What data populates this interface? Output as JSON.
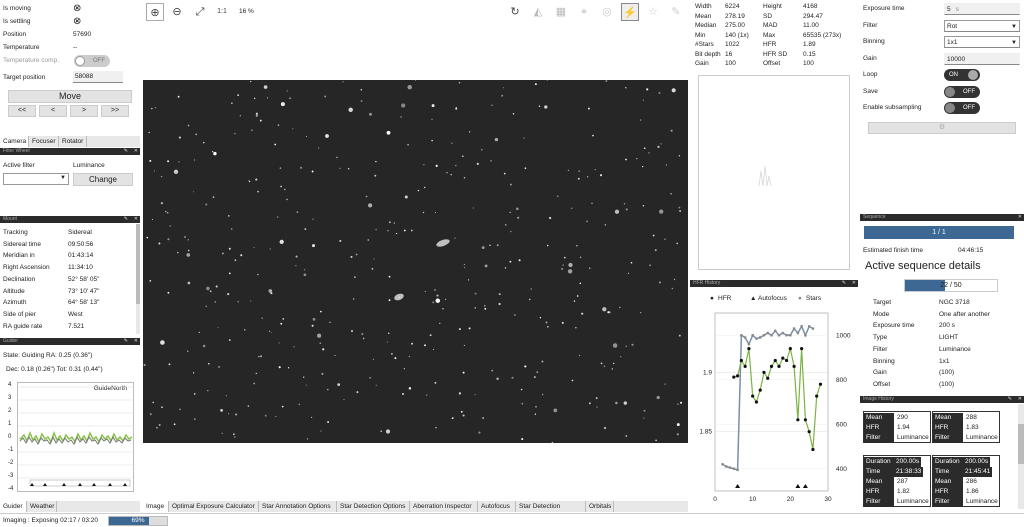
{
  "focuser": {
    "rows": [
      {
        "k": "Is moving",
        "v": "⊗"
      },
      {
        "k": "Is settling",
        "v": "⊗"
      },
      {
        "k": "Position",
        "v": "57690"
      },
      {
        "k": "Temperature",
        "v": "--"
      },
      {
        "k": "Temperature comp.",
        "v": ""
      }
    ],
    "temp_comp_toggle": "OFF",
    "target_label": "Target position",
    "target_value": "58088",
    "move_label": "Move",
    "step_buttons": [
      "<<",
      "<",
      ">",
      ">>"
    ]
  },
  "left_tabs": [
    "Camera",
    "Focuser",
    "Rotator"
  ],
  "filter_wheel": {
    "title": "Filter Wheel",
    "active_label": "Active filter",
    "active_value": "Luminance",
    "change_label": "Change"
  },
  "mount": {
    "title": "Mount",
    "rows": [
      {
        "k": "Tracking",
        "v": "Sidereal"
      },
      {
        "k": "Sidereal time",
        "v": "09:50:56"
      },
      {
        "k": "Meridian in",
        "v": "01:43:14"
      },
      {
        "k": "Right Ascension",
        "v": "11:34:10"
      },
      {
        "k": "Declination",
        "v": "52° 58' 05\""
      },
      {
        "k": "Altitude",
        "v": "73° 10' 47\""
      },
      {
        "k": "Azimuth",
        "v": "64° 58' 13\""
      },
      {
        "k": "Side of pier",
        "v": "West"
      },
      {
        "k": "RA guide rate",
        "v": "7.521"
      }
    ]
  },
  "guider": {
    "title": "Guider",
    "state_line": "State: Guiding  RA: 0.25 (0.36\")",
    "dec_line": "Dec: 0.18 (0.26\")  Tot: 0.31 (0.44\")",
    "graph_label": "GuideNorth",
    "y_ticks": [
      "4",
      "3",
      "2",
      "1",
      "0",
      "-1",
      "-2",
      "-3",
      "-4"
    ]
  },
  "bottom_left_tabs": [
    "Guider",
    "Weather"
  ],
  "toolbar": {
    "zoom_label": "1:1",
    "zoom_percent": "16 %"
  },
  "image_tabs": [
    "Image",
    "Optimal Exposure Calculator",
    "Star Annotation Options",
    "Star Detection Options",
    "Aberration Inspector",
    "Autofocus",
    "Star Detection Results",
    "Orbitals"
  ],
  "stats": {
    "rows": [
      [
        "Width",
        "6224",
        "Height",
        "4168"
      ],
      [
        "Mean",
        "278.19",
        "SD",
        "294.47"
      ],
      [
        "Median",
        "275.00",
        "MAD",
        "11.00"
      ],
      [
        "Min",
        "140 (1x)",
        "Max",
        "65535 (273x)"
      ],
      [
        "#Stars",
        "1022",
        "HFR",
        "1.89"
      ],
      [
        "Bit depth",
        "16",
        "HFR SD",
        "0.15"
      ],
      [
        "Gain",
        "100",
        "Offset",
        "100"
      ]
    ]
  },
  "hfr_history": {
    "title": "HFR History",
    "legend": [
      "HFR",
      "Autofocus",
      "Stars"
    ]
  },
  "chart_data": {
    "type": "line",
    "x_ticks": [
      "0",
      "10",
      "20",
      "30"
    ],
    "y_left_ticks": [
      "1.9",
      "1.85"
    ],
    "y_right_ticks": [
      "1000",
      "800",
      "600",
      "400"
    ],
    "xlim": [
      0,
      30
    ],
    "ylim_left": [
      1.8,
      1.95
    ],
    "ylim_right": [
      300,
      1100
    ],
    "series": [
      {
        "name": "HFR",
        "values": [
          [
            5,
            1.896
          ],
          [
            6,
            1.897
          ],
          [
            7,
            1.91
          ],
          [
            8,
            1.905
          ],
          [
            9,
            1.92
          ],
          [
            10,
            1.88
          ],
          [
            11,
            1.875
          ],
          [
            12,
            1.885
          ],
          [
            13,
            1.9
          ],
          [
            14,
            1.895
          ],
          [
            15,
            1.905
          ],
          [
            16,
            1.91
          ],
          [
            17,
            1.905
          ],
          [
            18,
            1.912
          ],
          [
            19,
            1.91
          ],
          [
            20,
            1.92
          ],
          [
            21,
            1.905
          ],
          [
            22,
            1.86
          ],
          [
            23,
            1.92
          ],
          [
            24,
            1.86
          ],
          [
            25,
            1.85
          ],
          [
            26,
            1.835
          ],
          [
            27,
            1.88
          ],
          [
            28,
            1.89
          ]
        ]
      },
      {
        "name": "Stars",
        "values": [
          [
            2,
            420
          ],
          [
            3,
            410
          ],
          [
            4,
            405
          ],
          [
            5,
            400
          ],
          [
            6,
            395
          ],
          [
            7,
            1000
          ],
          [
            8,
            990
          ],
          [
            9,
            960
          ],
          [
            10,
            1000
          ],
          [
            11,
            985
          ],
          [
            12,
            990
          ],
          [
            13,
            1000
          ],
          [
            14,
            1010
          ],
          [
            15,
            1000
          ],
          [
            16,
            1020
          ],
          [
            17,
            1000
          ],
          [
            18,
            1010
          ],
          [
            19,
            1000
          ],
          [
            20,
            1000
          ],
          [
            21,
            1030
          ],
          [
            22,
            1010
          ],
          [
            23,
            1040
          ],
          [
            24,
            1000
          ],
          [
            25,
            1040
          ],
          [
            26,
            1030
          ]
        ]
      },
      {
        "name": "Autofocus",
        "values": [
          [
            6,
            330
          ],
          [
            22,
            330
          ],
          [
            24,
            330
          ]
        ]
      }
    ]
  },
  "camera_settings": {
    "rows": [
      {
        "k": "Exposure time",
        "v": "5",
        "unit": "s"
      },
      {
        "k": "Filter",
        "v": "Rot"
      },
      {
        "k": "Binning",
        "v": "1x1"
      },
      {
        "k": "Gain",
        "v": "10000"
      },
      {
        "k": "Loop",
        "v": "ON"
      },
      {
        "k": "Save",
        "v": "OFF"
      },
      {
        "k": "Enable subsampling",
        "v": "OFF"
      }
    ]
  },
  "sequence": {
    "title": "Sequence",
    "progress_text": "1 / 1",
    "finish_label": "Estimated finish time",
    "finish_value": "04:46:15",
    "details_title": "Active sequence details",
    "sub_progress_text": "22 / 50",
    "sub_progress": 0.44,
    "rows": [
      {
        "k": "Target",
        "v": "NGC 3718"
      },
      {
        "k": "Mode",
        "v": "One after another"
      },
      {
        "k": "Exposure time",
        "v": "200 s"
      },
      {
        "k": "Type",
        "v": "LIGHT"
      },
      {
        "k": "Filter",
        "v": "Luminance"
      },
      {
        "k": "Binning",
        "v": "1x1"
      },
      {
        "k": "Gain",
        "v": "(100)"
      },
      {
        "k": "Offset",
        "v": "(100)"
      }
    ]
  },
  "image_history": {
    "title": "Image History",
    "cards": [
      {
        "rows": [
          [
            "Mean",
            "290"
          ],
          [
            "HFR",
            "1.94"
          ],
          [
            "Filter",
            "Luminance"
          ]
        ]
      },
      {
        "rows": [
          [
            "Mean",
            "288"
          ],
          [
            "HFR",
            "1.83"
          ],
          [
            "Filter",
            "Luminance"
          ]
        ]
      },
      {
        "rows": [
          [
            "Duration",
            "200.00s"
          ],
          [
            "Time",
            "21:38:33"
          ],
          [
            "Mean",
            "287"
          ],
          [
            "HFR",
            "1.82"
          ],
          [
            "Filter",
            "Luminance"
          ]
        ]
      },
      {
        "rows": [
          [
            "Duration",
            "200.00s"
          ],
          [
            "Time",
            "21:45:41"
          ],
          [
            "Mean",
            "286"
          ],
          [
            "HFR",
            "1.86"
          ],
          [
            "Filter",
            "Luminance"
          ]
        ]
      }
    ]
  },
  "status_bar": {
    "text": "Imaging :  Exposing 02:17 / 03:20",
    "progress_text": "69%",
    "progress": 0.69
  }
}
